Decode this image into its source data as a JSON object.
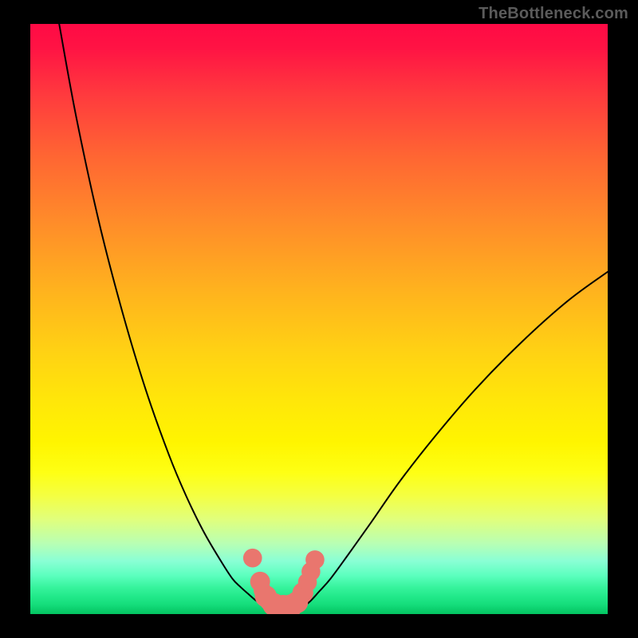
{
  "watermark": "TheBottleneck.com",
  "colors": {
    "background": "#000000",
    "curve_stroke": "#000000",
    "marker_fill": "#e9766e",
    "watermark_color": "#5b5b5b"
  },
  "chart_data": {
    "type": "line",
    "title": "",
    "xlabel": "",
    "ylabel": "",
    "xlim": [
      0,
      100
    ],
    "ylim": [
      0,
      100
    ],
    "grid": false,
    "series": [
      {
        "name": "left-curve",
        "x": [
          5,
          8,
          12,
          16,
          20,
          24,
          27,
          30,
          33,
          35,
          36.5,
          38,
          39.2,
          40.5,
          41.5
        ],
        "y": [
          100,
          84,
          66,
          51,
          38,
          27,
          20,
          14,
          9,
          6,
          4.5,
          3.2,
          2.2,
          1.4,
          1.0
        ]
      },
      {
        "name": "right-curve",
        "x": [
          47,
          48.5,
          50,
          52,
          55,
          59,
          64,
          70,
          77,
          85,
          93,
          100
        ],
        "y": [
          1.0,
          2.2,
          3.8,
          6,
          10,
          15.5,
          22.5,
          30,
          38,
          46,
          53,
          58
        ]
      },
      {
        "name": "bottom-valley",
        "x": [
          41.5,
          42.2,
          43,
          44,
          45,
          46,
          47
        ],
        "y": [
          1.0,
          0.5,
          0.3,
          0.2,
          0.3,
          0.5,
          1.0
        ]
      }
    ],
    "markers": [
      {
        "x": 38.5,
        "y": 9.5,
        "r": 1.2
      },
      {
        "x": 39.8,
        "y": 5.5,
        "r": 1.3
      },
      {
        "x": 40.8,
        "y": 3.0,
        "r": 1.5
      },
      {
        "x": 42.2,
        "y": 1.6,
        "r": 1.6
      },
      {
        "x": 43.8,
        "y": 1.3,
        "r": 1.6
      },
      {
        "x": 45.2,
        "y": 1.4,
        "r": 1.6
      },
      {
        "x": 46.2,
        "y": 2.0,
        "r": 1.5
      },
      {
        "x": 47.2,
        "y": 3.6,
        "r": 1.4
      },
      {
        "x": 48.0,
        "y": 5.4,
        "r": 1.2
      },
      {
        "x": 48.6,
        "y": 7.2,
        "r": 1.2
      },
      {
        "x": 49.3,
        "y": 9.2,
        "r": 1.2
      }
    ]
  }
}
